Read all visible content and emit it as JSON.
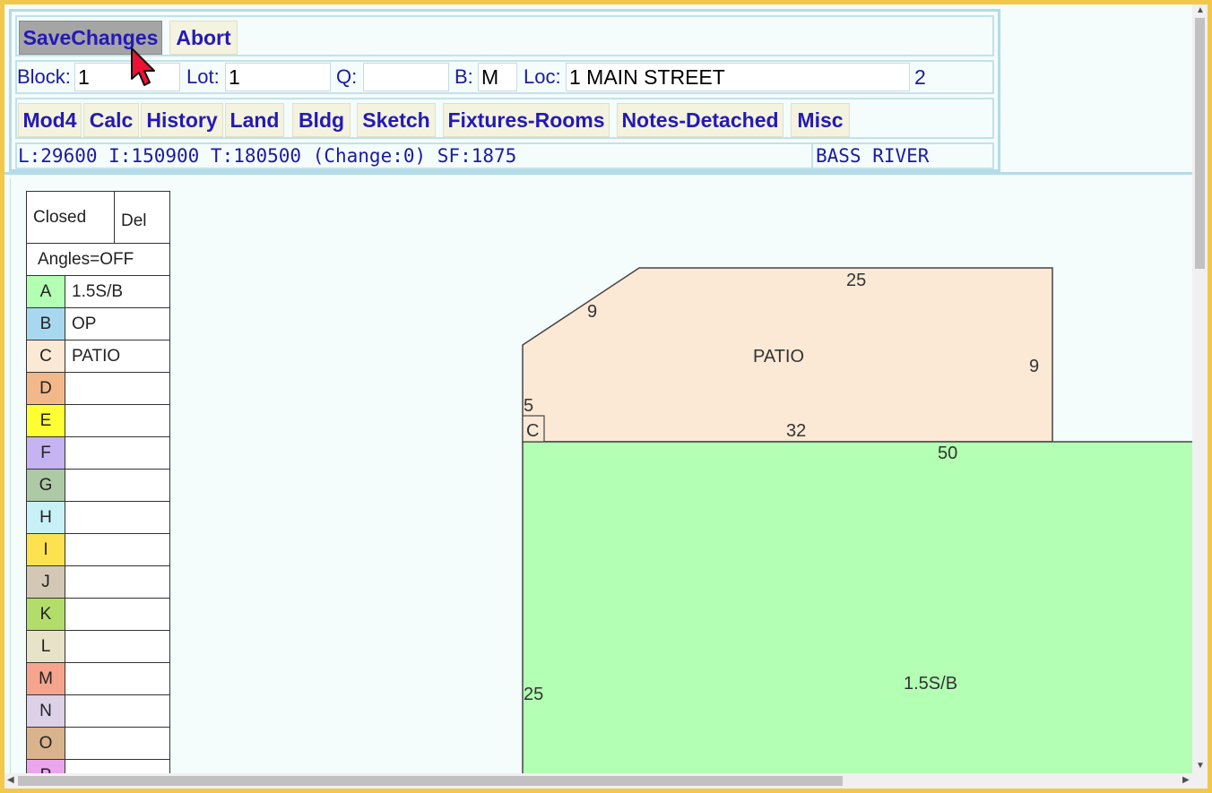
{
  "toolbar": {
    "save_label": "SaveChanges",
    "abort_label": "Abort"
  },
  "fields": {
    "block_label": "Block:",
    "block_value": "1",
    "lot_label": "Lot:",
    "lot_value": "1",
    "q_label": "Q:",
    "q_value": "",
    "b_label": "B:",
    "b_value": "M",
    "loc_label": "Loc:",
    "loc_value": "1 MAIN STREET",
    "count": "2"
  },
  "nav": {
    "tabs": [
      "Mod4",
      "Calc",
      "History",
      "Land",
      "Bldg",
      "Sketch",
      "Fixtures-Rooms",
      "Notes-Detached",
      "Misc"
    ]
  },
  "summary": {
    "values": "L:29600 I:150900 T:180500 (Change:0) SF:1875",
    "neighborhood": "BASS RIVER"
  },
  "legend": {
    "closed_label": "Closed",
    "del_label": "Del",
    "angles_label": "Angles=OFF",
    "rows": [
      {
        "code": "A",
        "desc": "1.5S/B",
        "color": "#b3ffb3"
      },
      {
        "code": "B",
        "desc": "OP",
        "color": "#a8d8f0"
      },
      {
        "code": "C",
        "desc": "PATIO",
        "color": "#fbe9d6"
      },
      {
        "code": "D",
        "desc": "",
        "color": "#f3b88a"
      },
      {
        "code": "E",
        "desc": "",
        "color": "#ffff33"
      },
      {
        "code": "F",
        "desc": "",
        "color": "#c5b3f2"
      },
      {
        "code": "G",
        "desc": "",
        "color": "#aec9a5"
      },
      {
        "code": "H",
        "desc": "",
        "color": "#c7f1f7"
      },
      {
        "code": "I",
        "desc": "",
        "color": "#fde24f"
      },
      {
        "code": "J",
        "desc": "",
        "color": "#d3c8b6"
      },
      {
        "code": "K",
        "desc": "",
        "color": "#b3dd6a"
      },
      {
        "code": "L",
        "desc": "",
        "color": "#e8e2c9"
      },
      {
        "code": "M",
        "desc": "",
        "color": "#f7a48e"
      },
      {
        "code": "N",
        "desc": "",
        "color": "#ddd1e8"
      },
      {
        "code": "O",
        "desc": "",
        "color": "#d9b38c"
      },
      {
        "code": "P",
        "desc": "",
        "color": "#e9a6ec"
      }
    ]
  },
  "drawing": {
    "patio": {
      "label": "PATIO",
      "tag": "C",
      "color": "#fbe9d6",
      "dims": [
        "25",
        "9",
        "9",
        "5",
        "32"
      ]
    },
    "main": {
      "label": "1.5S/B",
      "color": "#b3ffb3",
      "dims": [
        "50",
        "25"
      ]
    }
  }
}
